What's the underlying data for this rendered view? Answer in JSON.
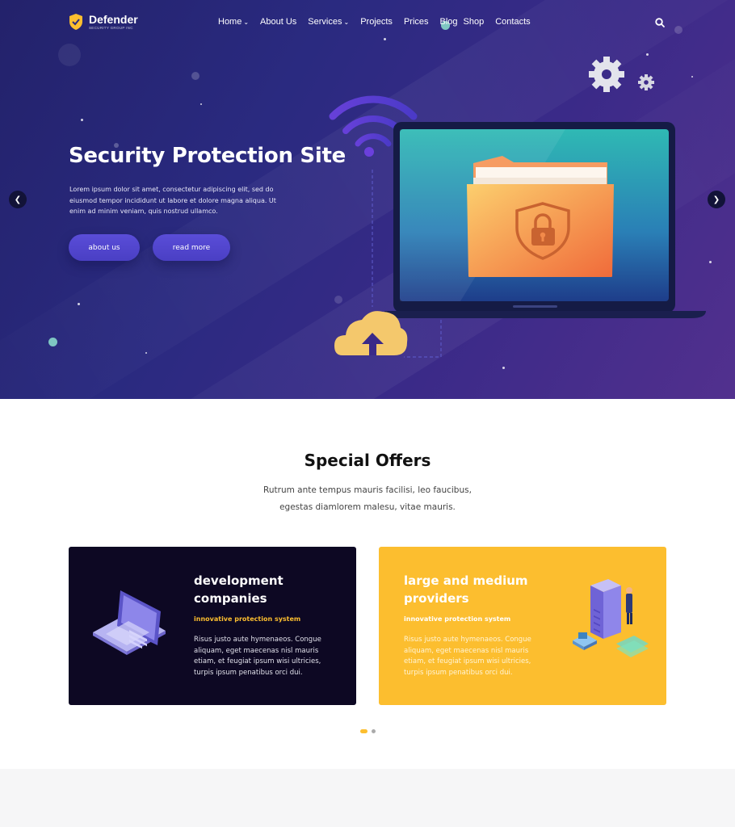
{
  "brand": {
    "name": "Defender",
    "tagline": "SECURITY GROUP INC"
  },
  "nav": {
    "items": [
      {
        "label": "Home",
        "has_dropdown": true
      },
      {
        "label": "About Us",
        "has_dropdown": false
      },
      {
        "label": "Services",
        "has_dropdown": true
      },
      {
        "label": "Projects",
        "has_dropdown": false
      },
      {
        "label": "Prices",
        "has_dropdown": false
      },
      {
        "label": "Blog",
        "has_dropdown": false
      },
      {
        "label": "Shop",
        "has_dropdown": false
      },
      {
        "label": "Contacts",
        "has_dropdown": false
      }
    ],
    "search_icon": "search-icon"
  },
  "hero": {
    "title": "Security Protection Site",
    "text": "Lorem ipsum dolor sit amet, consectetur adipiscing elit, sed do eiusmod tempor incididunt ut labore et dolore magna aliqua. Ut enim ad minim veniam, quis nostrud ullamco.",
    "buttons": {
      "about": "about us",
      "read": "read more"
    },
    "prev_icon": "chevron-left-icon",
    "next_icon": "chevron-right-icon"
  },
  "offers": {
    "title": "Special Offers",
    "subtitle_lines": [
      "Rutrum ante tempus mauris facilisi, leo faucibus,",
      "egestas diamlorem malesu, vitae mauris."
    ],
    "cards": [
      {
        "title": "development companies",
        "tag": "innovative protection system",
        "body": "Risus justo aute hymenaeos. Congue aliquam, eget maecenas nisl mauris etiam, et feugiat ipsum wisi ultricies, turpis ipsum penatibus orci dui."
      },
      {
        "title": "large and medium providers",
        "tag": "innovative protection system",
        "body": "Risus justo aute hymenaeos. Congue aliquam, eget maecenas nisl mauris etiam, et feugiat ipsum wisi ultricies, turpis ipsum penatibus orci dui."
      }
    ]
  },
  "colors": {
    "hero_start": "#23226b",
    "hero_end": "#52308e",
    "accent": "#fcbe2f",
    "button": "#5a4dd8",
    "dark_card": "#0d0823"
  }
}
